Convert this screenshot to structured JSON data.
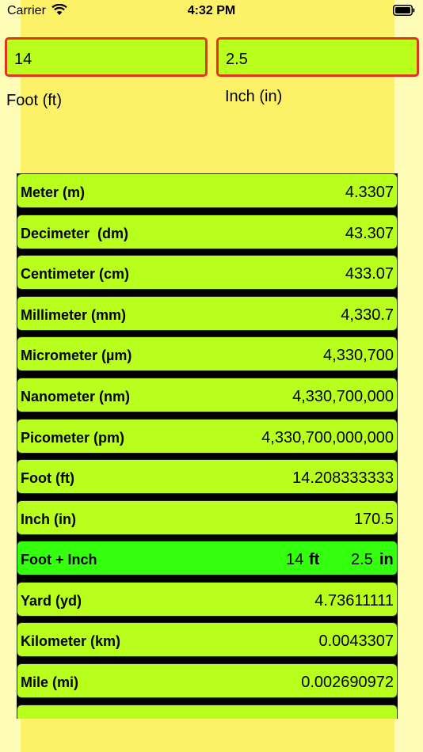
{
  "status_bar": {
    "carrier": "Carrier",
    "time": "4:32 PM"
  },
  "inputs": {
    "foot": {
      "value": "14",
      "label": "Foot (ft)"
    },
    "inch": {
      "value": "2.5",
      "label": "Inch (in)"
    }
  },
  "colors": {
    "background": "#fefdb7",
    "center_band": "#fdf167",
    "row": "#b8ff1e",
    "row_highlight": "#33ff0f",
    "input_border": "#e5341c"
  },
  "results": [
    {
      "name": "Meter (m)",
      "value": "4.3307"
    },
    {
      "name": "Decimeter  (dm)",
      "value": "43.307"
    },
    {
      "name": "Centimeter (cm)",
      "value": "433.07"
    },
    {
      "name": "Millimeter (mm)",
      "value": "4,330.7"
    },
    {
      "name": "Micrometer (µm)",
      "value": "4,330,700"
    },
    {
      "name": "Nanometer (nm)",
      "value": "4,330,700,000"
    },
    {
      "name": "Picometer (pm)",
      "value": "4,330,700,000,000"
    },
    {
      "name": "Foot (ft)",
      "value": "14.208333333"
    },
    {
      "name": "Inch (in)",
      "value": "170.5"
    },
    {
      "name": "Foot + Inch",
      "feet": "14",
      "feet_unit": "ft",
      "inches": "2.5",
      "inches_unit": "in"
    },
    {
      "name": "Yard (yd)",
      "value": "4.73611111"
    },
    {
      "name": "Kilometer (km)",
      "value": "0.0043307"
    },
    {
      "name": "Mile (mi)",
      "value": "0.002690972"
    }
  ]
}
